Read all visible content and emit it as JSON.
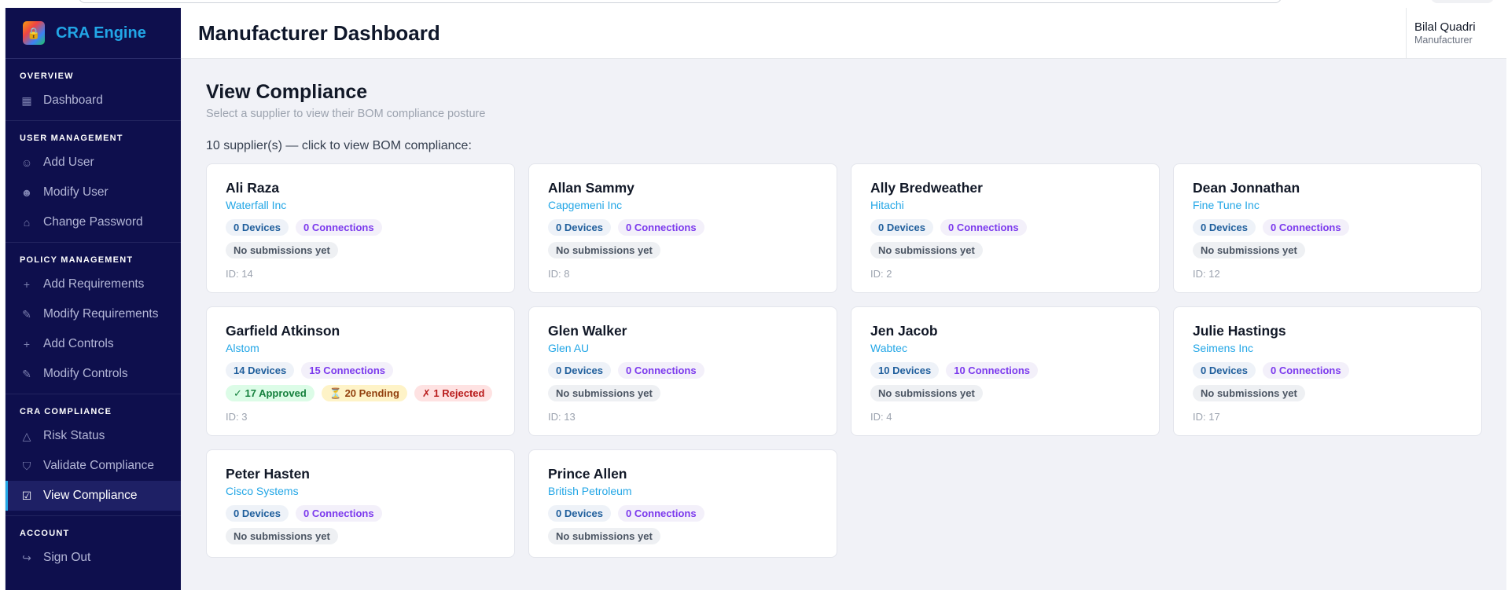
{
  "brand": {
    "name": "CRA Engine",
    "logo_icon": "shield-lock-icon",
    "accent": "#22a6e6"
  },
  "sidebar": {
    "sections": [
      {
        "heading": "OVERVIEW",
        "items": [
          {
            "label": "Dashboard",
            "icon": "grid-icon"
          }
        ]
      },
      {
        "heading": "USER MANAGEMENT",
        "items": [
          {
            "label": "Add User",
            "icon": "user-plus-icon"
          },
          {
            "label": "Modify User",
            "icon": "user-edit-icon"
          },
          {
            "label": "Change Password",
            "icon": "lock-icon"
          }
        ]
      },
      {
        "heading": "POLICY MANAGEMENT",
        "items": [
          {
            "label": "Add Requirements",
            "icon": "plus-icon"
          },
          {
            "label": "Modify Requirements",
            "icon": "pencil-icon"
          },
          {
            "label": "Add Controls",
            "icon": "plus-icon"
          },
          {
            "label": "Modify Controls",
            "icon": "pencil-icon"
          }
        ]
      },
      {
        "heading": "CRA COMPLIANCE",
        "items": [
          {
            "label": "Risk Status",
            "icon": "warning-triangle-icon"
          },
          {
            "label": "Validate Compliance",
            "icon": "shield-check-icon"
          },
          {
            "label": "View Compliance",
            "icon": "checkbox-icon",
            "active": true
          }
        ]
      },
      {
        "heading": "ACCOUNT",
        "items": [
          {
            "label": "Sign Out",
            "icon": "sign-out-icon"
          }
        ]
      }
    ]
  },
  "header": {
    "title": "Manufacturer Dashboard",
    "user_name": "Bilal Quadri",
    "user_role": "Manufacturer"
  },
  "page": {
    "title": "View Compliance",
    "subtitle": "Select a supplier to view their BOM compliance posture",
    "count_text": "10 supplier(s) — click to view BOM compliance:"
  },
  "suppliers": [
    {
      "name": "Ali Raza",
      "company": "Waterfall Inc",
      "devices": "0 Devices",
      "connections": "0 Connections",
      "status": [
        "No submissions yet"
      ],
      "id": "ID: 14"
    },
    {
      "name": "Allan Sammy",
      "company": "Capgemeni Inc",
      "devices": "0 Devices",
      "connections": "0 Connections",
      "status": [
        "No submissions yet"
      ],
      "id": "ID: 8"
    },
    {
      "name": "Ally Bredweather",
      "company": "Hitachi",
      "devices": "0 Devices",
      "connections": "0 Connections",
      "status": [
        "No submissions yet"
      ],
      "id": "ID: 2"
    },
    {
      "name": "Dean Jonnathan",
      "company": "Fine Tune Inc",
      "devices": "0 Devices",
      "connections": "0 Connections",
      "status": [
        "No submissions yet"
      ],
      "id": "ID: 12"
    },
    {
      "name": "Garfield Atkinson",
      "company": "Alstom",
      "devices": "14 Devices",
      "connections": "15 Connections",
      "approved": "✓ 17 Approved",
      "pending": "⏳ 20 Pending",
      "rejected": "✗ 1 Rejected",
      "id": "ID: 3"
    },
    {
      "name": "Glen Walker",
      "company": "Glen AU",
      "devices": "0 Devices",
      "connections": "0 Connections",
      "status": [
        "No submissions yet"
      ],
      "id": "ID: 13"
    },
    {
      "name": "Jen Jacob",
      "company": "Wabtec",
      "devices": "10 Devices",
      "connections": "10 Connections",
      "status": [
        "No submissions yet"
      ],
      "id": "ID: 4"
    },
    {
      "name": "Julie Hastings",
      "company": "Seimens Inc",
      "devices": "0 Devices",
      "connections": "0 Connections",
      "status": [
        "No submissions yet"
      ],
      "id": "ID: 17"
    },
    {
      "name": "Peter Hasten",
      "company": "Cisco Systems",
      "devices": "0 Devices",
      "connections": "0 Connections",
      "status": [
        "No submissions yet"
      ],
      "id": ""
    },
    {
      "name": "Prince Allen",
      "company": "British Petroleum",
      "devices": "0 Devices",
      "connections": "0 Connections",
      "status": [
        "No submissions yet"
      ],
      "id": ""
    }
  ]
}
